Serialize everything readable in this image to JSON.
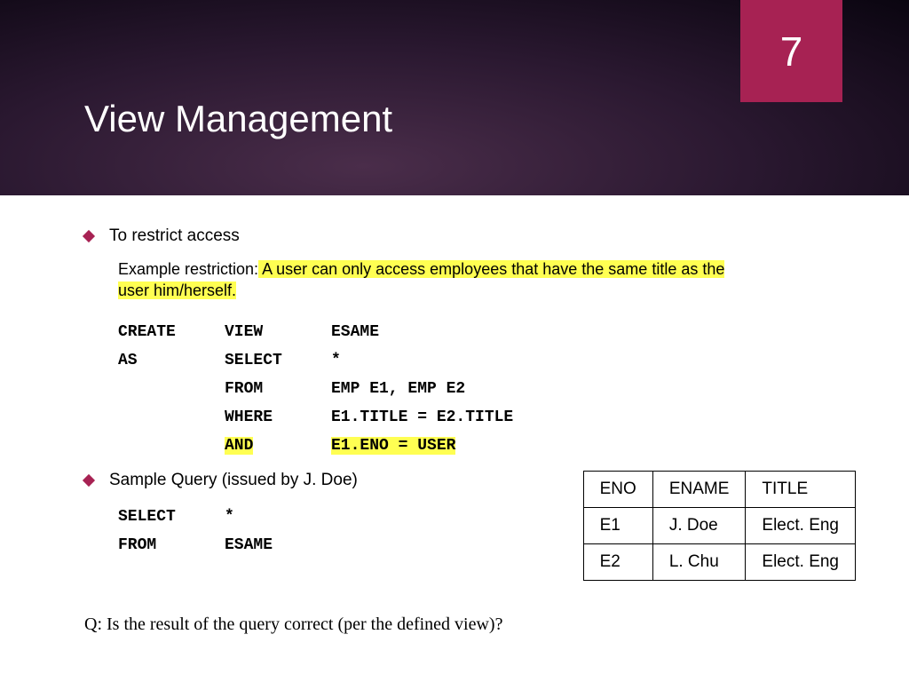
{
  "pageNumber": "7",
  "title": "View Management",
  "bullet1": "To restrict access",
  "exampleLabel": "Example restriction:",
  "exampleText1": " A user can only access employees that have the same title as the ",
  "exampleText2": "user him/herself.",
  "code": {
    "r1c1": "CREATE",
    "r1c2": "VIEW",
    "r1c3": "ESAME",
    "r2c1": "AS",
    "r2c2": "SELECT",
    "r2c3": "*",
    "r3c2": "FROM",
    "r3c3": "EMP E1, EMP E2",
    "r4c2": "WHERE",
    "r4c3": "E1.TITLE = E2.TITLE",
    "r5c2": "AND",
    "r5c3": "E1.ENO = USER"
  },
  "bullet2": "Sample Query (issued by J. Doe)",
  "query": {
    "r1c1": "SELECT",
    "r1c2": "*",
    "r2c1": "FROM",
    "r2c2": "ESAME"
  },
  "table": {
    "h1": "ENO",
    "h2": "ENAME",
    "h3": "TITLE",
    "r1c1": "E1",
    "r1c2": "J. Doe",
    "r1c3": "Elect. Eng",
    "r2c1": "E2",
    "r2c2": "L. Chu",
    "r2c3": "Elect. Eng"
  },
  "question": "Q: Is the result of the query correct (per the defined view)?"
}
